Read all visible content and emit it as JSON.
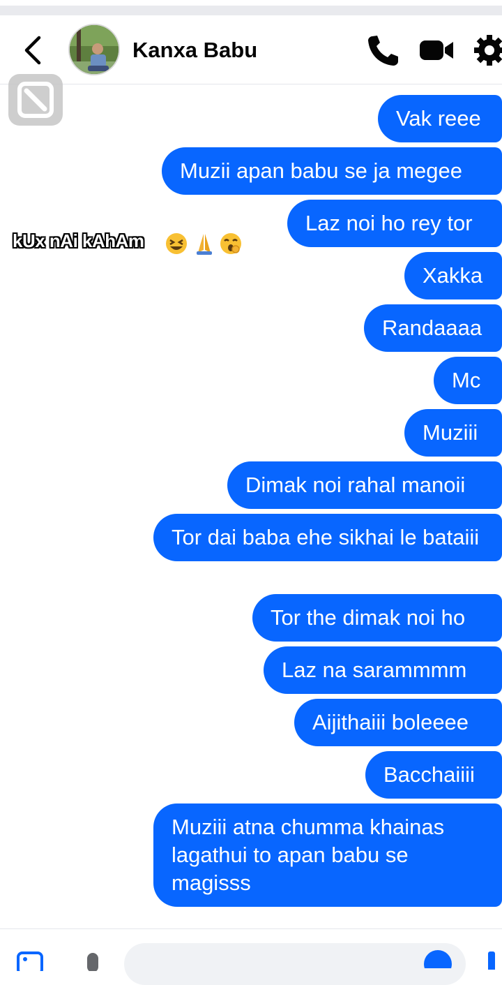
{
  "header": {
    "contact_name": "Kanxa Babu"
  },
  "icons": {
    "back": "chevron-left-icon",
    "call": "phone-icon",
    "video": "video-camera-icon",
    "settings": "gear-icon"
  },
  "colors": {
    "bubble": "#0866ff",
    "bubble_text": "#ffffff",
    "icon": "#050505"
  },
  "overlay_caption": "kUx nAi kAhAm",
  "messages": [
    {
      "text": "Vak reee",
      "sender": "me"
    },
    {
      "text": "Muzii apan babu se ja megee",
      "sender": "me"
    },
    {
      "text": "Laz noi ho rey tor",
      "sender": "me"
    },
    {
      "text": "Xakka",
      "sender": "me"
    },
    {
      "text": "Randaaaa",
      "sender": "me"
    },
    {
      "text": "Mc",
      "sender": "me"
    },
    {
      "text": "Muziii",
      "sender": "me"
    },
    {
      "text": "Dimak noi rahal manoii",
      "sender": "me"
    },
    {
      "text": "Tor dai baba ehe sikhai le bataiii",
      "sender": "me"
    },
    {
      "text": "Tor the dimak noi ho",
      "sender": "me"
    },
    {
      "text": "Laz na sarammmm",
      "sender": "me"
    },
    {
      "text": "Aijithaiii boleeee",
      "sender": "me"
    },
    {
      "text": "Bacchaiiii",
      "sender": "me"
    },
    {
      "text": "Muziii atna chumma khainas lagathui to apan babu se magisss",
      "sender": "me"
    }
  ]
}
